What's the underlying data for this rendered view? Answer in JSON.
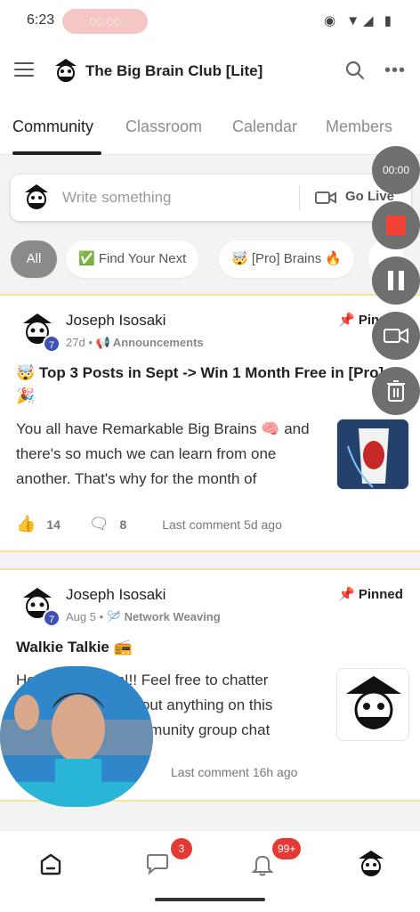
{
  "status_bar": {
    "time": "6:23",
    "recording_pill": "00:00"
  },
  "app_bar": {
    "title": "The Big Brain Club [Lite]"
  },
  "tabs": [
    {
      "label": "Community",
      "active": true
    },
    {
      "label": "Classroom",
      "active": false
    },
    {
      "label": "Calendar",
      "active": false
    },
    {
      "label": "Members",
      "active": false
    }
  ],
  "composer": {
    "placeholder": "Write something",
    "go_live_label": "Go Live"
  },
  "chips": [
    {
      "label": "All",
      "active": true
    },
    {
      "label": "✅ Find Your Next",
      "active": false
    },
    {
      "label": "🤯 [Pro] Brains 🔥",
      "active": false
    }
  ],
  "recorder": {
    "timer": "00:00"
  },
  "posts": [
    {
      "author": "Joseph Isosaki",
      "level": "7",
      "age": "27d",
      "category": "📢 Announcements",
      "pinned_label": "Pinned",
      "title": "🤯 Top 3 Posts in Sept -> Win 1 Month Free in [Pro] 🎉",
      "body": "You all have Remarkable Big Brains 🧠 and there's so much we can learn from one another. That's why for the month of",
      "likes": "14",
      "comments": "8",
      "last_comment": "Last comment 5d ago"
    },
    {
      "author": "Joseph Isosaki",
      "level": "7",
      "age": "Aug 5",
      "category": "🪡 Network Weaving",
      "pinned_label": "Pinned",
      "title": "Walkie Talkie 📻",
      "body_line1": "He        g Brains!!! Feel free to chatter",
      "body_line2": "about anything on this",
      "body_line3": "mmunity group chat",
      "last_comment": "Last comment 16h ago"
    }
  ],
  "bottom_nav": {
    "chat_badge": "3",
    "notifications_badge": "99+"
  },
  "colors": {
    "accent_badge": "#3f51b5",
    "pin_border": "#f6e29b",
    "alert": "#e53935",
    "record": "#f44336"
  }
}
